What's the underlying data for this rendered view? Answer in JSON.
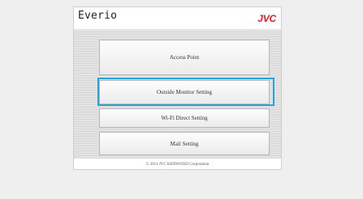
{
  "header": {
    "brand": "Everio",
    "logo": "JVC"
  },
  "menu": {
    "buttons": [
      {
        "label": "Access Point"
      },
      {
        "label": "Outside Monitor Setting"
      },
      {
        "label": "Wi-Fi Direct Setting"
      },
      {
        "label": "Mail Setting"
      }
    ],
    "focused_index": 1
  },
  "footer": {
    "copyright": "© 2011 JVC KENWOOD Corporation"
  },
  "colors": {
    "logo": "#e01f26",
    "focus": "#28a3d6",
    "background": "#efefef"
  }
}
